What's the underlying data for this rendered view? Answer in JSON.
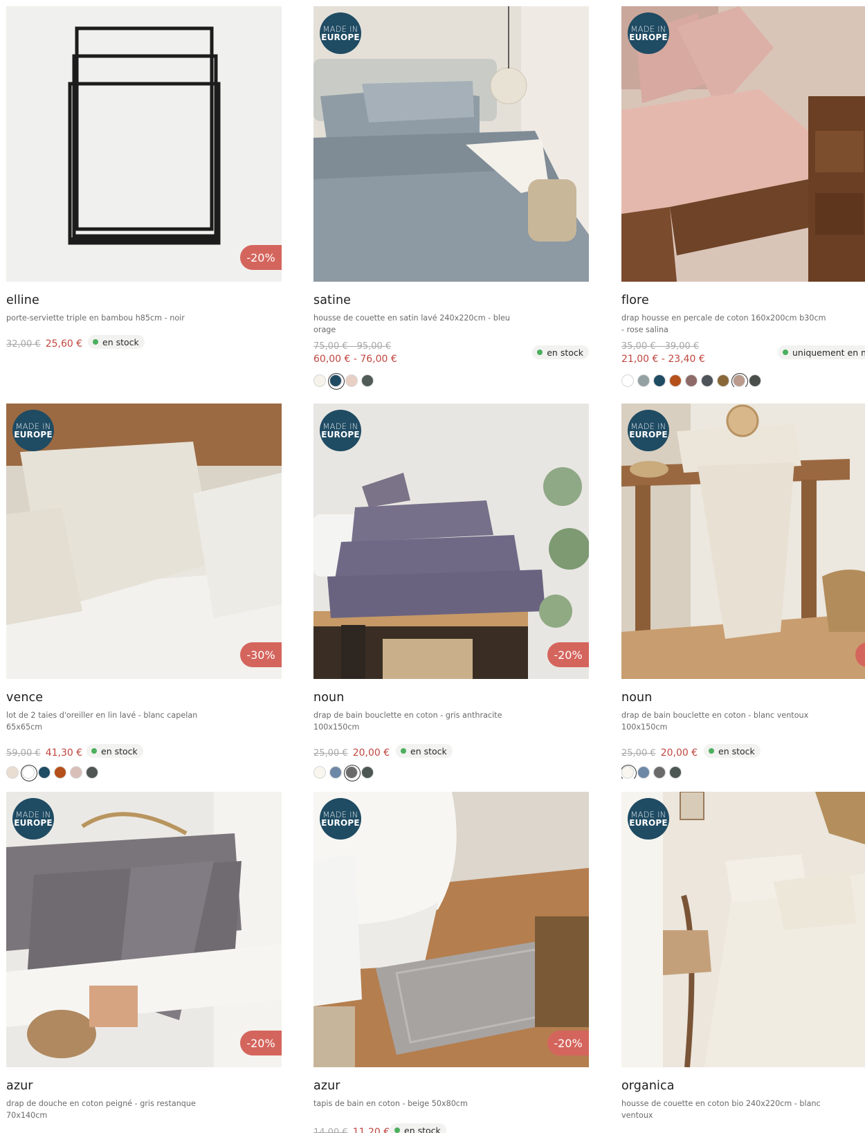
{
  "badges": {
    "made_in_line1": "MADE IN",
    "made_in_line2": "EUROPE"
  },
  "colors": {
    "discount_badge": "#d4655d",
    "sale_price": "#c0463f",
    "stock_dot": "#4caf5e",
    "europe_badge": "#1f4b63"
  },
  "products": [
    {
      "name": "elline",
      "desc": "porte-serviette triple en bambou h85cm - noir",
      "old_price": "32,00 €",
      "new_price": "25,60 €",
      "stock": "en stock",
      "discount": "-20%",
      "made_in_europe": false,
      "swatches": []
    },
    {
      "name": "satine",
      "desc": "housse de couette en satin lavé 240x220cm - bleu orage",
      "old_price": "75,00 € - 95,00 €",
      "new_price": "60,00 € - 76,00 €",
      "stock": "en stock",
      "discount": "",
      "made_in_europe": true,
      "swatches": [
        "#f6f3ea",
        "#1f4b63",
        "#e8cfc4",
        "#505a56"
      ],
      "selected_swatch": 1
    },
    {
      "name": "flore",
      "desc": "drap housse en percale de coton 160x200cm b30cm - rose salina",
      "old_price": "35,00 € - 39,00 €",
      "new_price": "21,00 € - 23,40 €",
      "stock": "uniquement en ma",
      "discount": "",
      "made_in_europe": true,
      "swatches": [
        "#ffffff",
        "#93a1a3",
        "#1f4b63",
        "#b5501a",
        "#8e6a66",
        "#4d5358",
        "#8a6738",
        "#b99a8c",
        "#4a4f4c"
      ],
      "selected_swatch": 7
    },
    {
      "name": "vence",
      "desc": "lot de 2 taies d'oreiller en lin lavé - blanc capelan 65x65cm",
      "old_price": "59,00 €",
      "new_price": "41,30 €",
      "stock": "en stock",
      "discount": "-30%",
      "made_in_europe": true,
      "swatches": [
        "#e8ddd0",
        "#ffffff",
        "#1f4b63",
        "#b5501a",
        "#d8bfb8",
        "#4f5654"
      ],
      "selected_swatch": 1
    },
    {
      "name": "noun",
      "desc": "drap de bain bouclette en coton - gris anthracite 100x150cm",
      "old_price": "25,00 €",
      "new_price": "20,00 €",
      "stock": "en stock",
      "discount": "-20%",
      "made_in_europe": true,
      "swatches": [
        "#f8f6ee",
        "#6d87a6",
        "#6a6a6a",
        "#4c5753"
      ],
      "selected_swatch": 2
    },
    {
      "name": "noun",
      "desc": "drap de bain bouclette en coton - blanc ventoux 100x150cm",
      "old_price": "25,00 €",
      "new_price": "20,00 €",
      "stock": "en stock",
      "discount": "",
      "made_in_europe": true,
      "swatches": [
        "#f8f6ee",
        "#6d87a6",
        "#6a6a6a",
        "#4c5753"
      ],
      "selected_swatch": 0
    },
    {
      "name": "azur",
      "desc": "drap de douche en coton peigné - gris restanque 70x140cm",
      "old_price": "",
      "new_price": "",
      "stock": "",
      "discount": "-20%",
      "made_in_europe": true,
      "swatches": []
    },
    {
      "name": "azur",
      "desc": "tapis de bain en coton - beige 50x80cm",
      "old_price": "14,00 €",
      "new_price": "11,20 €",
      "stock": "en stock",
      "discount": "-20%",
      "made_in_europe": true,
      "swatches": []
    },
    {
      "name": "organica",
      "desc": "housse de couette en coton bio 240x220cm - blanc ventoux",
      "old_price": "",
      "new_price": "",
      "stock": "",
      "discount": "",
      "made_in_europe": true,
      "swatches": []
    }
  ]
}
